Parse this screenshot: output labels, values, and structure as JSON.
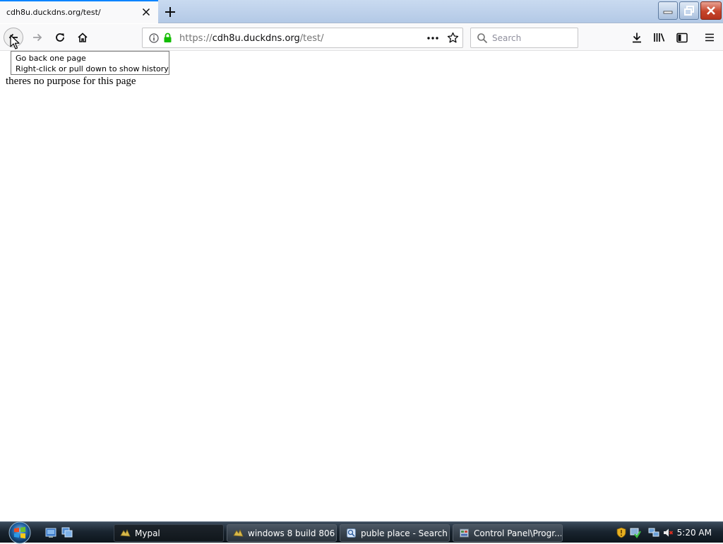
{
  "browser": {
    "tab": {
      "title": "cdh8u.duckdns.org/test/"
    },
    "url": {
      "prefix": "https://",
      "host": "cdh8u.duckdns.org",
      "path": "/test/"
    },
    "search": {
      "placeholder": "Search"
    },
    "tooltip": {
      "line1": "Go back one page",
      "line2": "Right-click or pull down to show history"
    },
    "accent_color": "#0a84ff",
    "secure_color": "#12bc00"
  },
  "page": {
    "body_text": "theres no purpose for this page"
  },
  "taskbar": {
    "buttons": [
      {
        "label": "Mypal",
        "icon": "mypal-icon"
      },
      {
        "label": "windows 8 build 806...",
        "icon": "folder-icon"
      },
      {
        "label": "puble place - Search...",
        "icon": "search-results-icon"
      },
      {
        "label": "Control Panel\\Progr...",
        "icon": "control-panel-icon"
      }
    ],
    "clock": "5:20 AM"
  }
}
